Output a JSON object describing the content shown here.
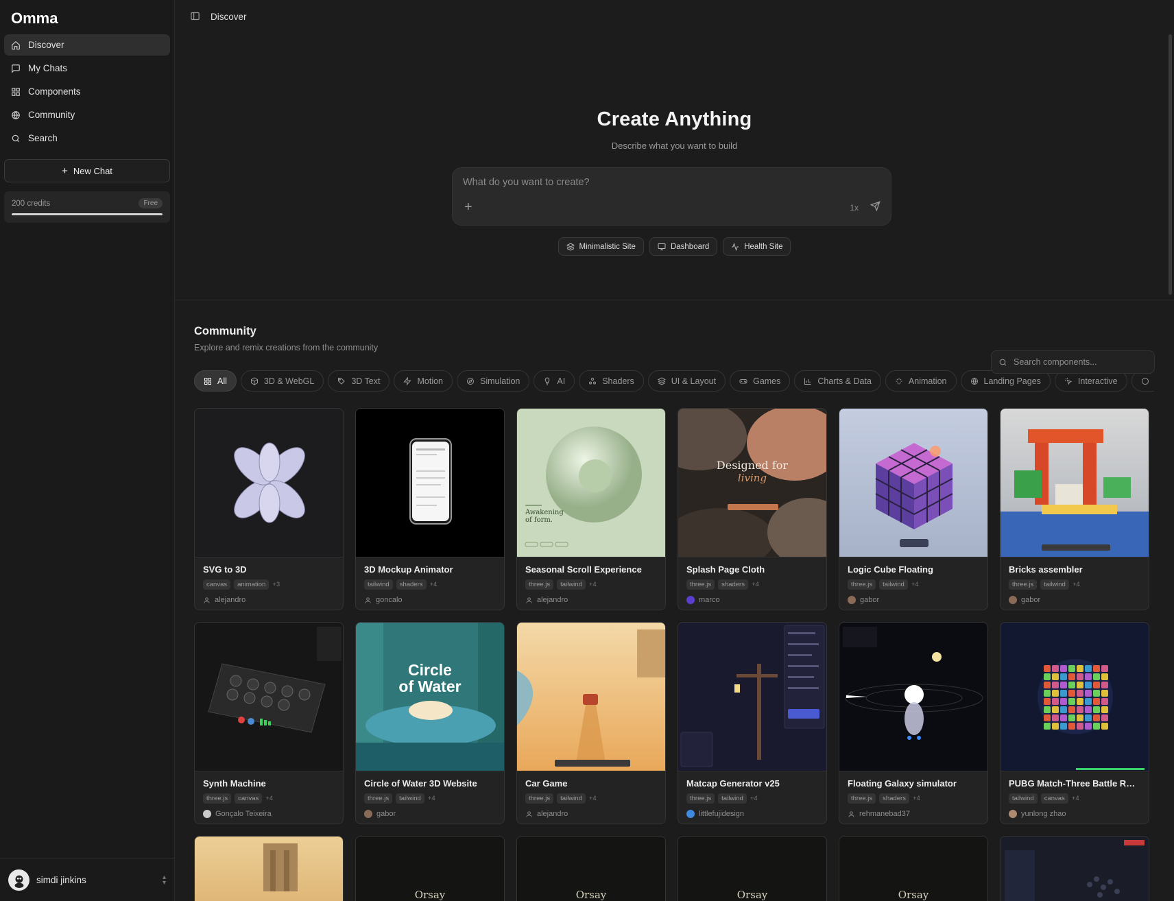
{
  "sidebar": {
    "brand": "Omma",
    "nav": [
      {
        "label": "Discover"
      },
      {
        "label": "My Chats"
      },
      {
        "label": "Components"
      },
      {
        "label": "Community"
      },
      {
        "label": "Search"
      }
    ],
    "new_chat": "New Chat",
    "credits": {
      "label": "200 credits",
      "badge": "Free",
      "progress": 1.0
    },
    "user": {
      "name": "simdi jinkins"
    }
  },
  "topbar": {
    "breadcrumb": "Discover"
  },
  "hero": {
    "title": "Create Anything",
    "subtitle": "Describe what you want to build",
    "prompt_placeholder": "What do you want to create?",
    "multiplier": "1x",
    "suggestions": [
      {
        "label": "Minimalistic Site",
        "icon": "layers-icon"
      },
      {
        "label": "Dashboard",
        "icon": "monitor-icon"
      },
      {
        "label": "Health Site",
        "icon": "activity-icon"
      }
    ]
  },
  "community": {
    "title": "Community",
    "subtitle": "Explore and remix creations from the community",
    "search_placeholder": "Search components...",
    "filters": [
      "All",
      "3D & WebGL",
      "3D Text",
      "Motion",
      "Simulation",
      "AI",
      "Shaders",
      "UI & Layout",
      "Games",
      "Charts & Data",
      "Animation",
      "Landing Pages",
      "Interactive"
    ],
    "cards": [
      {
        "title": "SVG to 3D",
        "tags": [
          "canvas",
          "animation"
        ],
        "more": "+3",
        "author": "alejandro",
        "avatar": false
      },
      {
        "title": "3D Mockup Animator",
        "tags": [
          "tailwind",
          "shaders"
        ],
        "more": "+4",
        "author": "goncalo",
        "avatar": false
      },
      {
        "title": "Seasonal Scroll Experience",
        "tags": [
          "three.js",
          "tailwind"
        ],
        "more": "+4",
        "author": "alejandro",
        "avatar": false
      },
      {
        "title": "Splash Page Cloth",
        "tags": [
          "three.js",
          "shaders"
        ],
        "more": "+4",
        "author": "marco",
        "avatar": true
      },
      {
        "title": "Logic Cube Floating",
        "tags": [
          "three.js",
          "tailwind"
        ],
        "more": "+4",
        "author": "gabor",
        "avatar": true
      },
      {
        "title": "Bricks assembler",
        "tags": [
          "three.js",
          "tailwind"
        ],
        "more": "+4",
        "author": "gabor",
        "avatar": true
      },
      {
        "title": "Synth Machine",
        "tags": [
          "three.js",
          "canvas"
        ],
        "more": "+4",
        "author": "Gonçalo Teixeira",
        "avatar": true
      },
      {
        "title": "Circle of Water 3D Website",
        "tags": [
          "three.js",
          "tailwind"
        ],
        "more": "+4",
        "author": "gabor",
        "avatar": true
      },
      {
        "title": "Car Game",
        "tags": [
          "three.js",
          "tailwind"
        ],
        "more": "+4",
        "author": "alejandro",
        "avatar": false
      },
      {
        "title": "Matcap Generator v25",
        "tags": [
          "three.js",
          "tailwind"
        ],
        "more": "+4",
        "author": "littlefujidesign",
        "avatar": true
      },
      {
        "title": "Floating Galaxy simulator",
        "tags": [
          "three.js",
          "shaders"
        ],
        "more": "+4",
        "author": "rehmanebad37",
        "avatar": false
      },
      {
        "title": "PUBG Match-Three Battle Roy...",
        "tags": [
          "tailwind",
          "canvas"
        ],
        "more": "+4",
        "author": "yunlong zhao",
        "avatar": true
      }
    ],
    "thumb_text": {
      "splash": "Designed for",
      "splash_italic": "living",
      "seasonal": "Awakening of form.",
      "water_1": "Circle",
      "water_2": "of Water",
      "orsay": "Orsay"
    }
  }
}
